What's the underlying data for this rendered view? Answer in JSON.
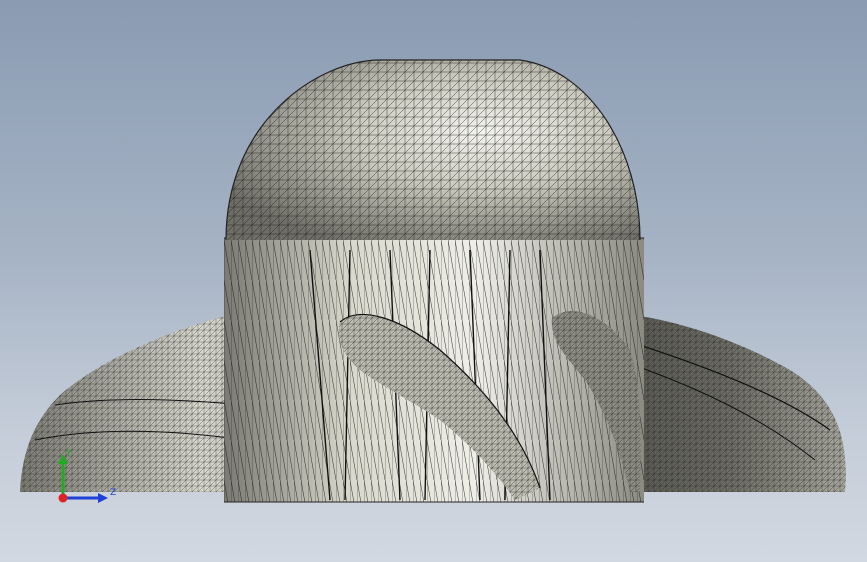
{
  "viewport": {
    "background_top": "#8a9bb2",
    "background_bottom": "#d2d8e1"
  },
  "model": {
    "display_mode": "mesh-wireframe-shaded",
    "surface_color": "#d8d8cc",
    "edge_color": "#1a1a1a",
    "shape": "impeller with dome hub and curved blades"
  },
  "triad": {
    "y_label": "Y",
    "z_label": "Z",
    "y_color": "#22aa22",
    "z_color": "#1f3fd8",
    "x_color": "#dd2222"
  }
}
